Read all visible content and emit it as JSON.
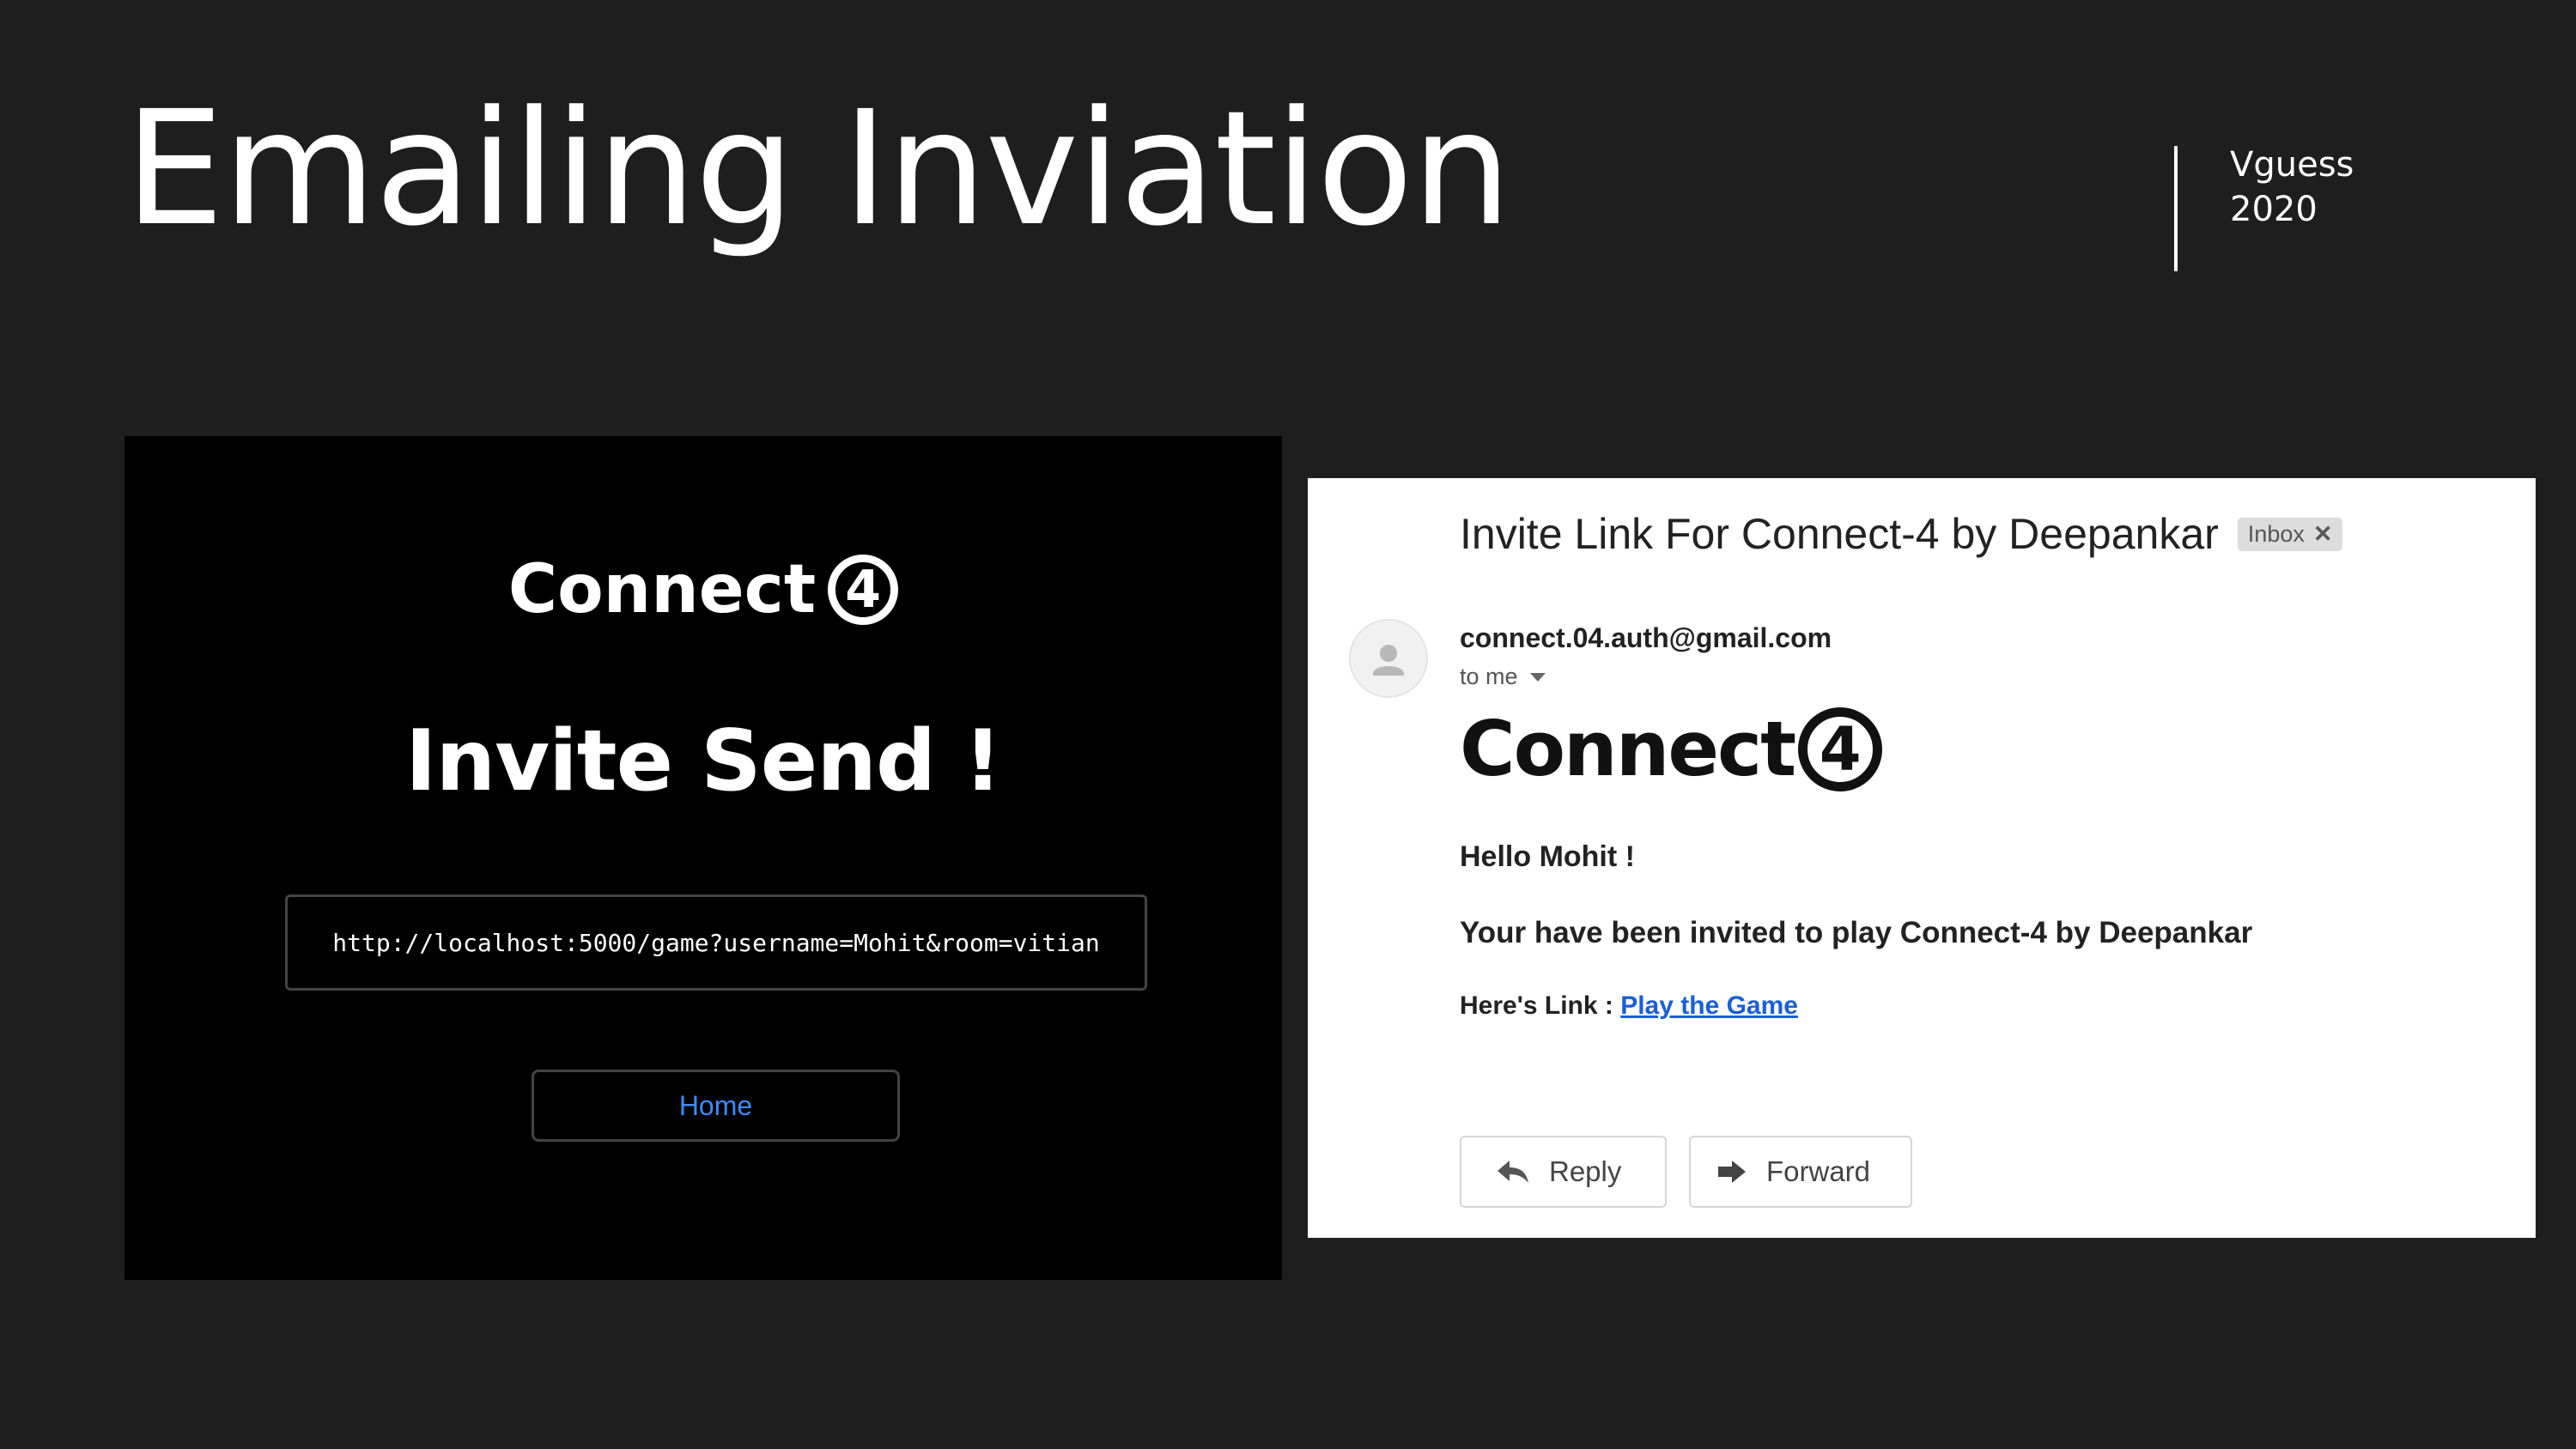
{
  "slide": {
    "title": "Emailing Inviation",
    "meta_line1": "Vguess",
    "meta_line2": "2020"
  },
  "app_screen": {
    "brand_text": "Connect",
    "brand_mark": "4",
    "heading": "Invite Send !",
    "invite_url": "http://localhost:5000/game?username=Mohit&room=vitian",
    "home_button_label": "Home",
    "colors": {
      "background": "#000000",
      "button_text": "#3d8bff"
    }
  },
  "email": {
    "subject": "Invite Link For Connect-4 by Deepankar",
    "label_badge": "Inbox",
    "label_close_icon": "close-icon",
    "avatar_icon": "person-icon",
    "sender": "connect.04.auth@gmail.com",
    "recipient": "to me",
    "recipient_dropdown_icon": "chevron-down-icon",
    "logo_text": "Connect",
    "logo_mark": "4",
    "greeting": "Hello Mohit !",
    "message": "Your have been invited to play Connect-4 by Deepankar",
    "link_prefix": "Here's Link : ",
    "link_text": "Play the Game",
    "reply_label": "Reply",
    "reply_icon": "reply-arrow-icon",
    "forward_label": "Forward",
    "forward_icon": "forward-arrow-icon",
    "colors": {
      "link": "#1a5fd6"
    }
  }
}
